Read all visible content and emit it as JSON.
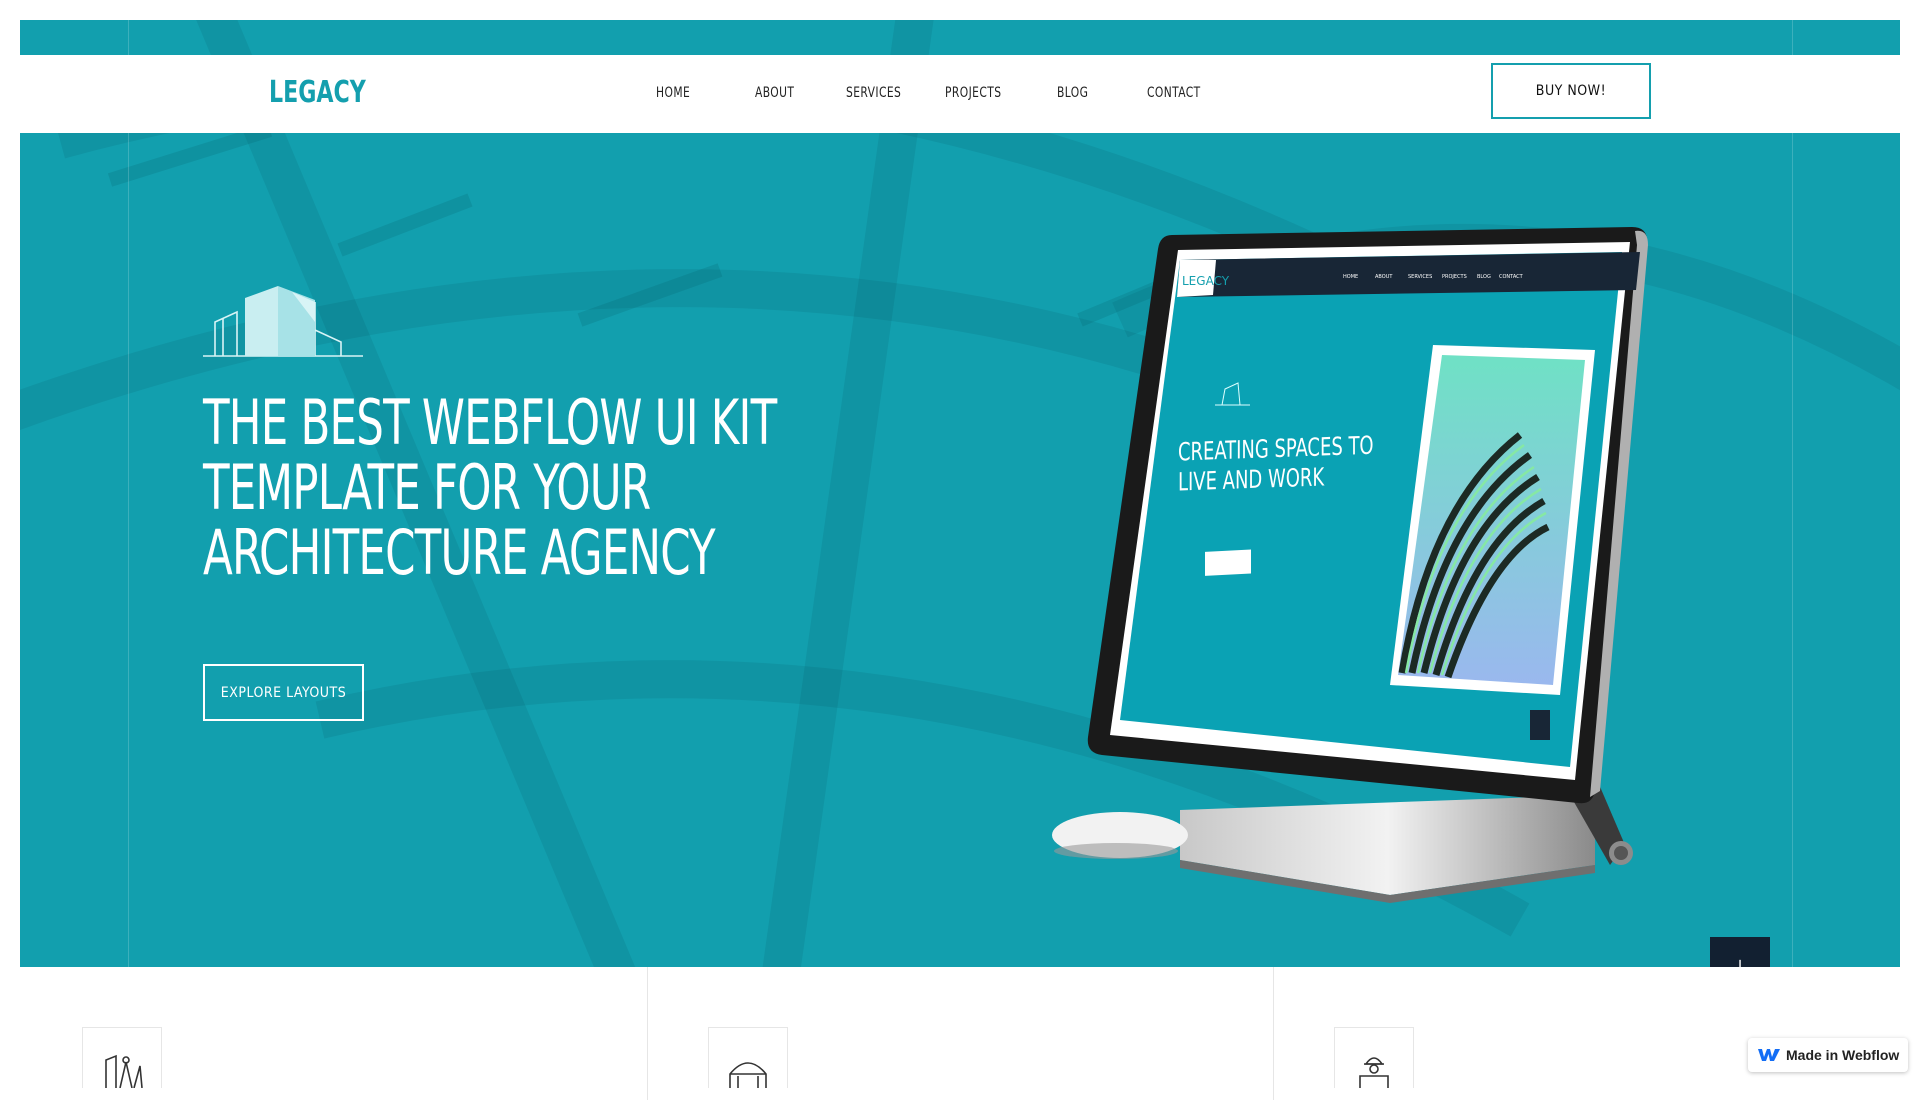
{
  "brand": {
    "logo": "LEGACY",
    "accent": "#149fae",
    "hero_bg": "#129fae",
    "dark": "#122031"
  },
  "nav": {
    "items": [
      {
        "label": "HOME"
      },
      {
        "label": "ABOUT"
      },
      {
        "label": "SERVICES"
      },
      {
        "label": "PROJECTS"
      },
      {
        "label": "BLOG"
      },
      {
        "label": "CONTACT"
      }
    ],
    "cta": "BUY NOW!"
  },
  "hero": {
    "icon": "buildings-outline-icon",
    "headline": [
      "THE BEST WEBFLOW UI KIT",
      "TEMPLATE FOR YOUR",
      "ARCHITECTURE AGENCY"
    ],
    "button": "EXPLORE LAYOUTS",
    "scroll_icon": "↓"
  },
  "mockup": {
    "logo": "LEGACY",
    "nav": [
      "HOME",
      "ABOUT",
      "SERVICES",
      "PROJECTS",
      "BLOG",
      "CONTACT"
    ],
    "headline": [
      "CREATING SPACES TO",
      "LIVE AND WORK"
    ]
  },
  "features": {
    "icons": [
      "drafting-tools-icon",
      "dome-building-icon",
      "worker-helmet-icon"
    ]
  },
  "badge": {
    "label": "Made in Webflow",
    "icon": "webflow-logo-icon"
  }
}
